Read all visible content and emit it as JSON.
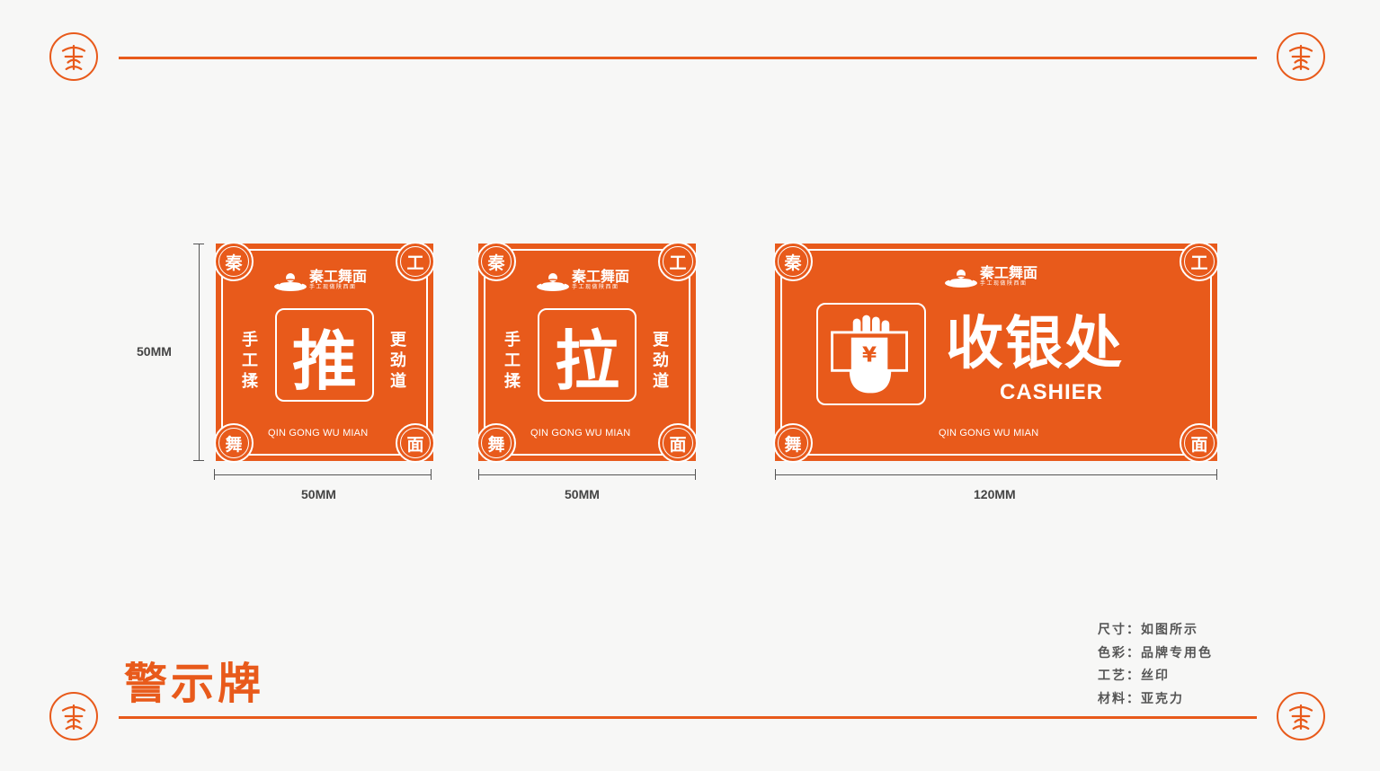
{
  "colors": {
    "brand": "#e85a1b",
    "text": "#555555",
    "background": "#f7f7f6"
  },
  "page": {
    "title": "警示牌"
  },
  "seal_icon": "qin-seal-icon",
  "signs": [
    {
      "corners": [
        "秦",
        "工",
        "舞",
        "面"
      ],
      "logo": {
        "brand": "秦工舞面",
        "tag": "手工现做陕西面"
      },
      "main": "推",
      "left_vertical": "手工揉",
      "right_vertical": "更劲道",
      "pinyin": "QIN GONG WU MIAN",
      "width_label": "50MM",
      "height_label": "50MM"
    },
    {
      "corners": [
        "秦",
        "工",
        "舞",
        "面"
      ],
      "logo": {
        "brand": "秦工舞面",
        "tag": "手工现做陕西面"
      },
      "main": "拉",
      "left_vertical": "手工揉",
      "right_vertical": "更劲道",
      "pinyin": "QIN GONG WU MIAN",
      "width_label": "50MM"
    },
    {
      "corners": [
        "秦",
        "工",
        "舞",
        "面"
      ],
      "logo": {
        "brand": "秦工舞面",
        "tag": "手工现做陕西面"
      },
      "main": "收银处",
      "main_en": "CASHIER",
      "icon": "cashier-hand-yen-icon",
      "pinyin": "QIN GONG WU MIAN",
      "width_label": "120MM"
    }
  ],
  "specs": [
    "尺寸：如图所示",
    "色彩：品牌专用色",
    "工艺：丝印",
    "材料：亚克力"
  ]
}
